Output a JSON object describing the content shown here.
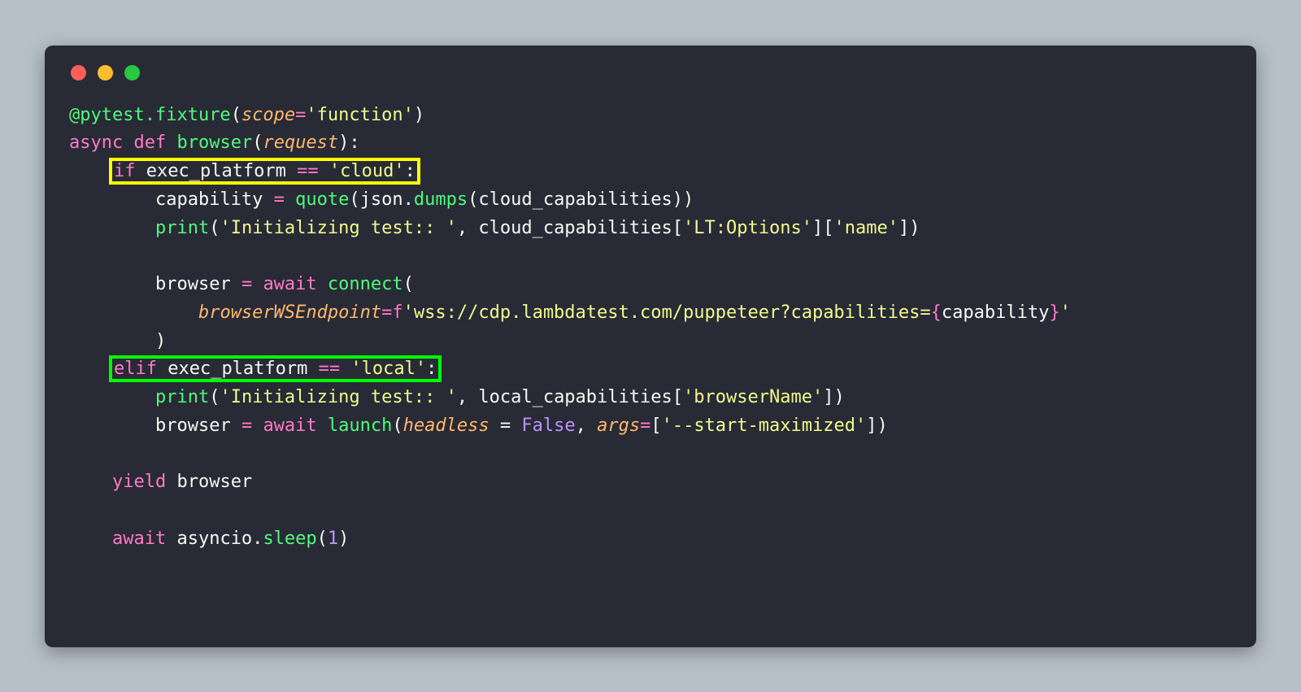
{
  "code": {
    "decorator_at": "@",
    "decorator_name": "pytest.fixture",
    "decorator_open": "(",
    "decorator_kw": "scope",
    "decorator_eq": "=",
    "decorator_val": "'function'",
    "decorator_close": ")",
    "async_kw": "async",
    "def_kw": "def",
    "funcname": "browser",
    "funcopen": "(",
    "funcparam": "request",
    "funcclose_colon": "):",
    "if_kw": "if",
    "if_cond_var": " exec_platform ",
    "if_cond_op": "==",
    "if_cond_val": " 'cloud'",
    "if_colon": ":",
    "cap_assign_lhs": "capability ",
    "eq1": "= ",
    "quote_call": "quote",
    "open1": "(",
    "json_obj": "json.",
    "dumps_call": "dumps",
    "open2": "(",
    "cloud_caps": "cloud_capabilities",
    "close2": "))",
    "print_call1": "print",
    "print1_open": "(",
    "print1_str": "'Initializing test:: '",
    "print1_comma": ", cloud_capabilities[",
    "print1_key1": "'LT:Options'",
    "print1_mid": "][",
    "print1_key2": "'name'",
    "print1_close": "])",
    "browser_assign": "browser ",
    "eq2": "= ",
    "await_kw": "await",
    "connect_call": " connect",
    "connect_open": "(",
    "bws_kw": "browserWSEndpoint",
    "bws_eq": "=",
    "f_prefix": "f",
    "f_open": "'",
    "f_body1": "wss://cdp.lambdatest.com/puppeteer?capabilities=",
    "f_brace_open": "{",
    "f_var": "capability",
    "f_brace_close": "}",
    "f_close": "'",
    "connect_close": ")",
    "elif_kw": "elif",
    "elif_cond_var": " exec_platform ",
    "elif_cond_op": "==",
    "elif_cond_val": " 'local'",
    "elif_colon": ":",
    "print_call2": "print",
    "print2_open": "(",
    "print2_str": "'Initializing test:: '",
    "print2_comma": ", local_capabilities[",
    "print2_key": "'browserName'",
    "print2_close": "])",
    "browser_assign2": "browser ",
    "eq3": "= ",
    "await_kw2": "await",
    "launch_call": " launch",
    "launch_open": "(",
    "headless_kw": "headless",
    "headless_eq_sp": " = ",
    "false_kw": "False",
    "args_comma": ", ",
    "args_kw": "args",
    "args_eq": "=",
    "args_open": "[",
    "args_val": "'--start-maximized'",
    "args_close": "])",
    "yield_kw": "yield",
    "yield_var": " browser",
    "await_kw3": "await",
    "asyncio_obj": " asyncio.",
    "sleep_call": "sleep",
    "sleep_open": "(",
    "sleep_val": "1",
    "sleep_close": ")"
  }
}
